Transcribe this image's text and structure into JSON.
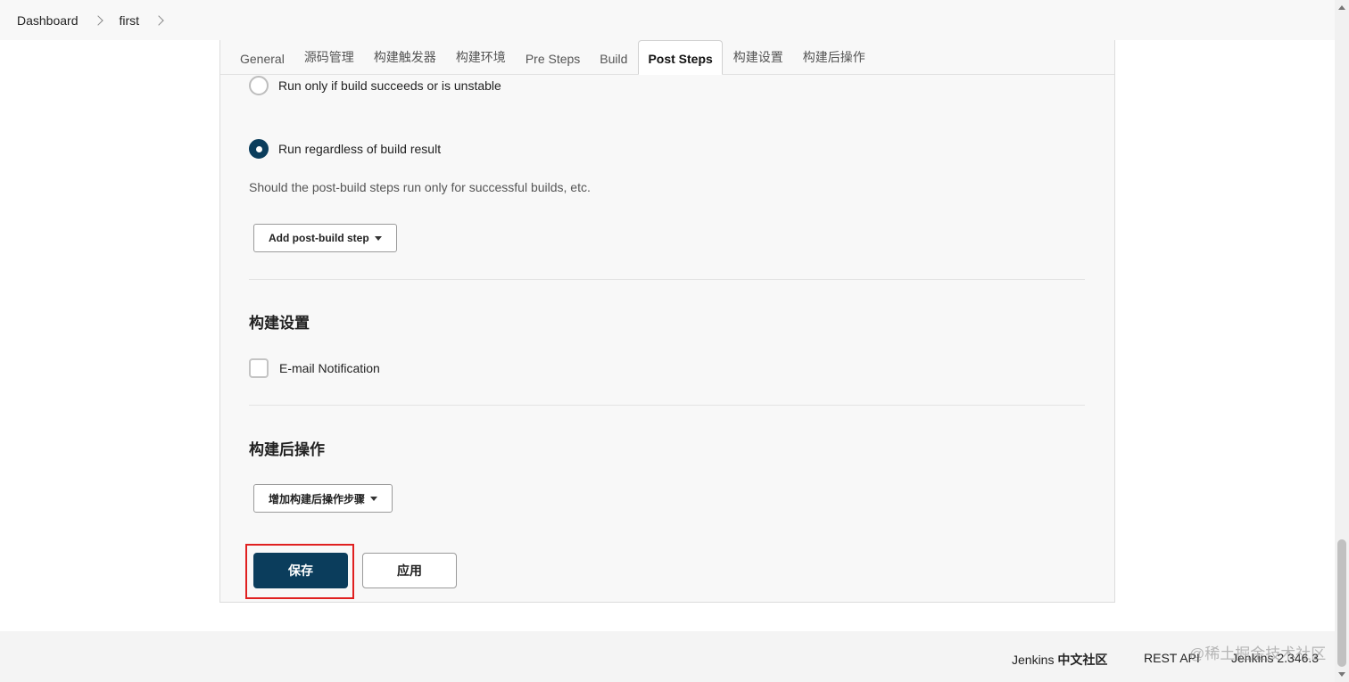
{
  "breadcrumb": {
    "items": [
      "Dashboard",
      "first"
    ]
  },
  "tabs": [
    "General",
    "源码管理",
    "构建触发器",
    "构建环境",
    "Pre Steps",
    "Build",
    "Post Steps",
    "构建设置",
    "构建后操作"
  ],
  "active_tab": "Post Steps",
  "post_steps": {
    "options": [
      {
        "label": "Run only if build succeeds or is unstable",
        "checked": false
      },
      {
        "label": "Run regardless of build result",
        "checked": true
      }
    ],
    "help": "Should the post-build steps run only for successful builds, etc.",
    "add_button": "Add post-build step"
  },
  "build_settings": {
    "title": "构建设置",
    "email_label": "E-mail Notification",
    "email_checked": false
  },
  "post_build": {
    "title": "构建后操作",
    "add_button": "增加构建后操作步骤"
  },
  "actions": {
    "save": "保存",
    "apply": "应用"
  },
  "footer": {
    "community_prefix": "Jenkins",
    "community_suffix": "中文社区",
    "rest_api": "REST API",
    "version": "Jenkins 2.346.3"
  },
  "watermark": "@稀土掘金技术社区",
  "colors": {
    "primary": "#0b3d5c",
    "highlight": "#e02020"
  }
}
